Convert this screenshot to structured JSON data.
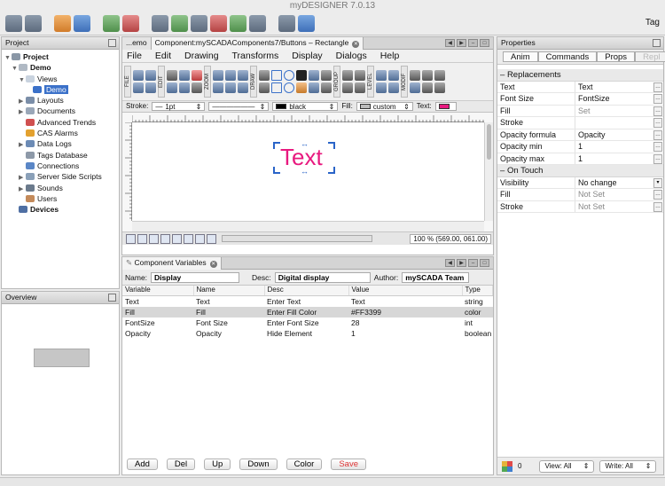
{
  "app": {
    "title": "myDESIGNER 7.0.13",
    "tag_label": "Tag"
  },
  "project_panel": {
    "title": "Project",
    "items": [
      {
        "label": "Project",
        "icon": "project-icon",
        "bold": true
      },
      {
        "label": "Demo",
        "icon": "folder-icon",
        "bold": true
      },
      {
        "label": "Views",
        "icon": "views-icon"
      },
      {
        "label": "Demo",
        "icon": "view-icon",
        "selected": true
      },
      {
        "label": "Layouts",
        "icon": "layouts-icon"
      },
      {
        "label": "Documents",
        "icon": "documents-icon"
      },
      {
        "label": "Advanced Trends",
        "icon": "trends-icon"
      },
      {
        "label": "CAS Alarms",
        "icon": "alarm-icon"
      },
      {
        "label": "Data Logs",
        "icon": "datalog-icon"
      },
      {
        "label": "Tags Database",
        "icon": "database-icon"
      },
      {
        "label": "Connections",
        "icon": "connections-icon"
      },
      {
        "label": "Server Side Scripts",
        "icon": "script-icon"
      },
      {
        "label": "Sounds",
        "icon": "sound-icon"
      },
      {
        "label": "Users",
        "icon": "users-icon"
      },
      {
        "label": "Devices",
        "icon": "devices-icon",
        "bold": true
      }
    ]
  },
  "overview_panel": {
    "title": "Overview"
  },
  "editor": {
    "tabs": [
      {
        "label": "...emo"
      },
      {
        "label": "Component:mySCADAComponents7/Buttons – Rectangle",
        "active": true
      }
    ],
    "menu": [
      "File",
      "Edit",
      "Drawing",
      "Transforms",
      "Display",
      "Dialogs",
      "Help"
    ],
    "tool_groups": [
      "FILE",
      "EDIT",
      "ZOOM",
      "DRAW",
      "GROUP",
      "LEVEL",
      "MODIF"
    ],
    "style": {
      "stroke_label": "Stroke:",
      "stroke_width": "1pt",
      "stroke_color": "black",
      "fill_label": "Fill:",
      "fill_value": "custom",
      "text_label": "Text:",
      "text_color": "#e8197f"
    },
    "canvas_text": "Text",
    "canvas_text_color": "#e8197f",
    "zoom": "100 % (569.00, 061.00)"
  },
  "component_vars": {
    "title": "Component Variables",
    "name_label": "Name:",
    "name_value": "Display",
    "desc_label": "Desc:",
    "desc_value": "Digital display",
    "author_label": "Author:",
    "author_value": "mySCADA Team",
    "columns": [
      "Variable",
      "Name",
      "Desc",
      "Value",
      "Type"
    ],
    "rows": [
      [
        "Text",
        "Text",
        "Enter Text",
        "Text",
        "string"
      ],
      [
        "Fill",
        "Fill",
        "Enter Fill Color",
        "#FF3399",
        "color"
      ],
      [
        "FontSize",
        "Font Size",
        "Enter Font Size",
        "28",
        "int"
      ],
      [
        "Opacity",
        "Opacity",
        "Hide Element",
        "1",
        "boolean"
      ]
    ],
    "buttons": {
      "add": "Add",
      "del": "Del",
      "up": "Up",
      "down": "Down",
      "color": "Color",
      "save": "Save"
    }
  },
  "properties": {
    "title": "Properties",
    "tabs": [
      "Anim",
      "Commands",
      "Props",
      "Repl"
    ],
    "sections": [
      {
        "title": "Replacements",
        "rows": [
          {
            "key": "Text",
            "value": "Text"
          },
          {
            "key": "Font Size",
            "value": "FontSize"
          },
          {
            "key": "Fill",
            "value": "Set",
            "dim": true
          },
          {
            "key": "Stroke",
            "value": ""
          },
          {
            "key": "Opacity formula",
            "value": "Opacity"
          },
          {
            "key": "Opacity min",
            "value": "1"
          },
          {
            "key": "Opacity max",
            "value": "1"
          }
        ]
      },
      {
        "title": "On Touch",
        "rows": [
          {
            "key": "Visibility",
            "value": "No change"
          },
          {
            "key": "Fill",
            "value": "Not Set",
            "dim": true
          },
          {
            "key": "Stroke",
            "value": "Not Set",
            "dim": true
          }
        ]
      }
    ],
    "footer": {
      "count": "0",
      "view": "View: All",
      "write": "Write: All"
    }
  }
}
